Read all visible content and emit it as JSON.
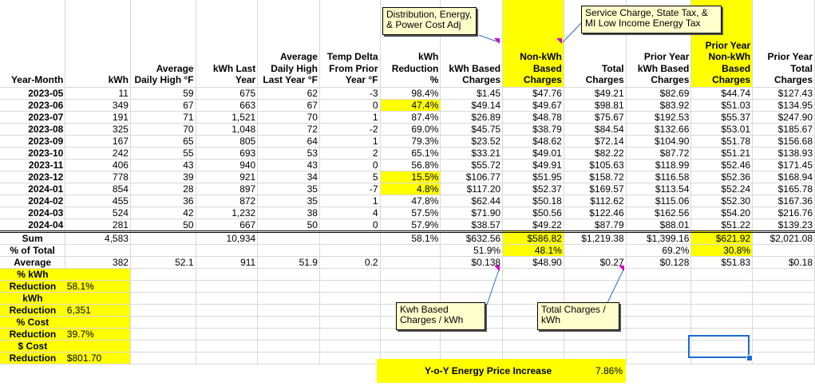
{
  "headers": {
    "c0": "Year-Month",
    "c1": "kWh",
    "c2": "Average Daily High °F",
    "c3": "kWh Last Year",
    "c4": "Average Daily High Last Year °F",
    "c5": "Temp Delta From Prior Year °F",
    "c6": "kWh Reduction %",
    "c7": "kWh Based Charges",
    "c8": "Non-kWh Based Charges",
    "c9": "Total Charges",
    "c10": "Prior Year kWh Based Charges",
    "c11": "Prior Year Non-kWh Based Charges",
    "c12": "Prior Year Total Charges"
  },
  "rows": [
    [
      "2023-05",
      "11",
      "59",
      "675",
      "62",
      "-3",
      "98.4%",
      "$1.45",
      "$47.76",
      "$49.21",
      "$82.69",
      "$44.74",
      "$127.43"
    ],
    [
      "2023-06",
      "349",
      "67",
      "663",
      "67",
      "0",
      "47.4%",
      "$49.14",
      "$49.67",
      "$98.81",
      "$83.92",
      "$51.03",
      "$134.95"
    ],
    [
      "2023-07",
      "191",
      "71",
      "1,521",
      "70",
      "1",
      "87.4%",
      "$26.89",
      "$48.78",
      "$75.67",
      "$192.53",
      "$55.37",
      "$247.90"
    ],
    [
      "2023-08",
      "325",
      "70",
      "1,048",
      "72",
      "-2",
      "69.0%",
      "$45.75",
      "$38.79",
      "$84.54",
      "$132.66",
      "$53.01",
      "$185.67"
    ],
    [
      "2023-09",
      "167",
      "65",
      "805",
      "64",
      "1",
      "79.3%",
      "$23.52",
      "$48.62",
      "$72.14",
      "$104.90",
      "$51.78",
      "$156.68"
    ],
    [
      "2023-10",
      "242",
      "55",
      "693",
      "53",
      "2",
      "65.1%",
      "$33.21",
      "$49.01",
      "$82.22",
      "$87.72",
      "$51.21",
      "$138.93"
    ],
    [
      "2023-11",
      "406",
      "43",
      "940",
      "43",
      "0",
      "56.8%",
      "$55.72",
      "$49.91",
      "$105.63",
      "$118.99",
      "$52.46",
      "$171.45"
    ],
    [
      "2023-12",
      "778",
      "39",
      "921",
      "34",
      "5",
      "15.5%",
      "$106.77",
      "$51.95",
      "$158.72",
      "$116.58",
      "$52.36",
      "$168.94"
    ],
    [
      "2024-01",
      "854",
      "28",
      "897",
      "35",
      "-7",
      "4.8%",
      "$117.20",
      "$52.37",
      "$169.57",
      "$113.54",
      "$52.24",
      "$165.78"
    ],
    [
      "2024-02",
      "455",
      "36",
      "872",
      "35",
      "1",
      "47.8%",
      "$62.44",
      "$50.18",
      "$112.62",
      "$115.06",
      "$52.30",
      "$167.36"
    ],
    [
      "2024-03",
      "524",
      "42",
      "1,232",
      "38",
      "4",
      "57.5%",
      "$71.90",
      "$50.56",
      "$122.46",
      "$162.56",
      "$54.20",
      "$216.76"
    ],
    [
      "2024-04",
      "281",
      "50",
      "667",
      "50",
      "0",
      "57.9%",
      "$38.57",
      "$49.22",
      "$87.79",
      "$88.01",
      "$51.22",
      "$139.23"
    ]
  ],
  "sum_row": [
    "Sum",
    "4,583",
    "",
    "10,934",
    "",
    "",
    "58.1%",
    "$632.56",
    "$586.82",
    "$1,219.38",
    "$1,399.16",
    "$621.92",
    "$2,021.08"
  ],
  "pct_row": [
    "% of Total",
    "",
    "",
    "",
    "",
    "",
    "",
    "51.9%",
    "48.1%",
    "",
    "69.2%",
    "30.8%",
    ""
  ],
  "avg_row": [
    "Average",
    "382",
    "52.1",
    "911",
    "51.9",
    "0.2",
    "",
    "$0.138",
    "$48.90",
    "$0.27",
    "$0.128",
    "$51.83",
    "$0.18"
  ],
  "summary": [
    {
      "label": "% kWh Reduction",
      "value": "58.1%"
    },
    {
      "label": "kWh Reduction",
      "value": "6,351"
    },
    {
      "label": "% Cost Reduction",
      "value": "39.7%"
    },
    {
      "label": "$ Cost Reduction",
      "value": "$801.70"
    }
  ],
  "yoy": {
    "label": "Y-o-Y Energy Price Increase",
    "value": "7.86%"
  },
  "comments": {
    "distribution": "Distribution, Energy, & Power Cost Adj",
    "service": "Service Charge, State Tax, & MI Low Income Energy Tax",
    "kwh_based": "Kwh Based Charges / kWh",
    "total_charges": "Total Charges / kWh"
  },
  "colors": {
    "highlight": "#ffff00",
    "comment_bg": "#ffffcc",
    "comment_marker": "#cc00cc",
    "selection": "#1c6bd4"
  }
}
